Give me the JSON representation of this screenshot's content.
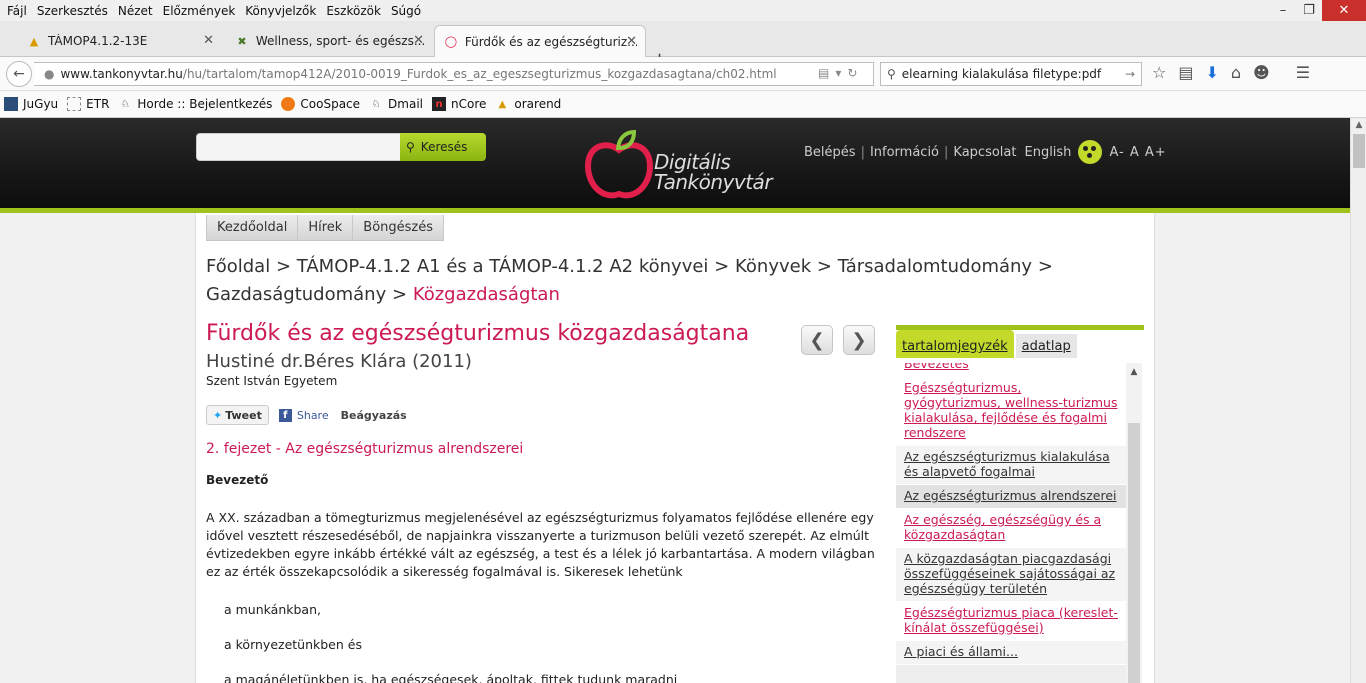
{
  "menubar": {
    "items": [
      {
        "label": "Fájl"
      },
      {
        "label": "Szerkesztés"
      },
      {
        "label": "Nézet"
      },
      {
        "label": "Előzmények"
      },
      {
        "label": "Könyvjelzők"
      },
      {
        "label": "Eszközök"
      },
      {
        "label": "Súgó"
      }
    ]
  },
  "tabs": [
    {
      "title": "TÁMOP4.1.2-13E",
      "icon": "pma-logo-icon"
    },
    {
      "title": "Wellness, sport- és egészs...",
      "icon": "tools-icon"
    },
    {
      "title": "Fürdők és az egészségturiz...",
      "icon": "apple-icon",
      "active": true
    }
  ],
  "navbar": {
    "url_domain": "www.tankonyvtar.hu",
    "url_path": "/hu/tartalom/tamop412A/2010-0019_Furdok_es_az_egeszsegturizmus_kozgazdasagtana/ch02.html",
    "search_query": "elearning kialakulása filetype:pdf"
  },
  "bookmarks": [
    {
      "label": "JuGyu",
      "icon": "bookmark-icon"
    },
    {
      "label": "ETR",
      "icon": "page-icon"
    },
    {
      "label": "Horde :: Bejelentkezés",
      "icon": "horde-icon"
    },
    {
      "label": "CooSpace",
      "icon": "coospace-icon"
    },
    {
      "label": "Dmail",
      "icon": "horde-icon"
    },
    {
      "label": "nCore",
      "icon": "ncore-icon"
    },
    {
      "label": "orarend",
      "icon": "pma-logo-icon"
    }
  ],
  "header": {
    "search_button": "Keresés",
    "logo_line1": "Digitális",
    "logo_line2": "Tankönyvtár",
    "links": [
      "Belépés",
      "Információ",
      "Kapcsolat"
    ],
    "english": "English",
    "font_sizes": "A- A A+"
  },
  "mainnav": [
    "Kezdőoldal",
    "Hírek",
    "Böngészés"
  ],
  "breadcrumb": {
    "items": [
      "Főoldal",
      "TÁMOP-4.1.2 A1 és a TÁMOP-4.1.2 A2 könyvei",
      "Könyvek",
      "Társadalomtudomány",
      "Gazdaságtudomány"
    ],
    "current": "Közgazdaságtan",
    "separator": ">"
  },
  "book": {
    "title": "Fürdők és az egészségturizmus közgazdaságtana",
    "author": "Hustiné dr.Béres Klára (2011)",
    "institution": "Szent István Egyetem"
  },
  "social": {
    "tweet": "Tweet",
    "share": "Share",
    "embed": "Beágyazás"
  },
  "chapter": {
    "title": "2. fejezet - Az egészségturizmus alrendszerei",
    "section": "Bevezető",
    "paragraph": "A XX. században a tömegturizmus megjelenésével az egészségturizmus folyamatos fejlődése ellenére egy idővel vesztett részesedéséből, de napjainkra visszanyerte a turizmuson belüli vezető szerepét. Az elmúlt évtizedekben egyre inkább értékké vált az egészség, a test és a lélek jó karbantartása. A modern világban ez az érték összekapcsolódik a sikeresség fogalmával is. Sikeresek lehetünk",
    "list": [
      "a munkánkban,",
      "a környezetünkben és",
      "a magánéletünkben is, ha egészségesek, ápoltak, fittek tudunk maradni"
    ]
  },
  "sidebar": {
    "tabs": [
      "tartalomjegyzék",
      "adatlap"
    ],
    "toc": [
      {
        "label": "Bevezetés",
        "style": "pink"
      },
      {
        "label": "Egészségturizmus, gyógyturizmus, wellness-turizmus kialakulása, fejlődése és fogalmi rendszere",
        "style": "pink"
      },
      {
        "label": "Az egészségturizmus kialakulása és alapvető fogalmai",
        "style": "gray"
      },
      {
        "label": "Az egészségturizmus alrendszerei",
        "style": "sel"
      },
      {
        "label": "Az egészség, egészségügy és a közgazdaságtan",
        "style": "pink"
      },
      {
        "label": "A közgazdaságtan piacgazdasági összefüggéseinek sajátosságai az egészségügy területén",
        "style": "gray"
      },
      {
        "label": "Egészségturizmus piaca (kereslet-kínálat összefüggései)",
        "style": "pink"
      },
      {
        "label": "A piaci és állami...",
        "style": "gray"
      }
    ]
  }
}
